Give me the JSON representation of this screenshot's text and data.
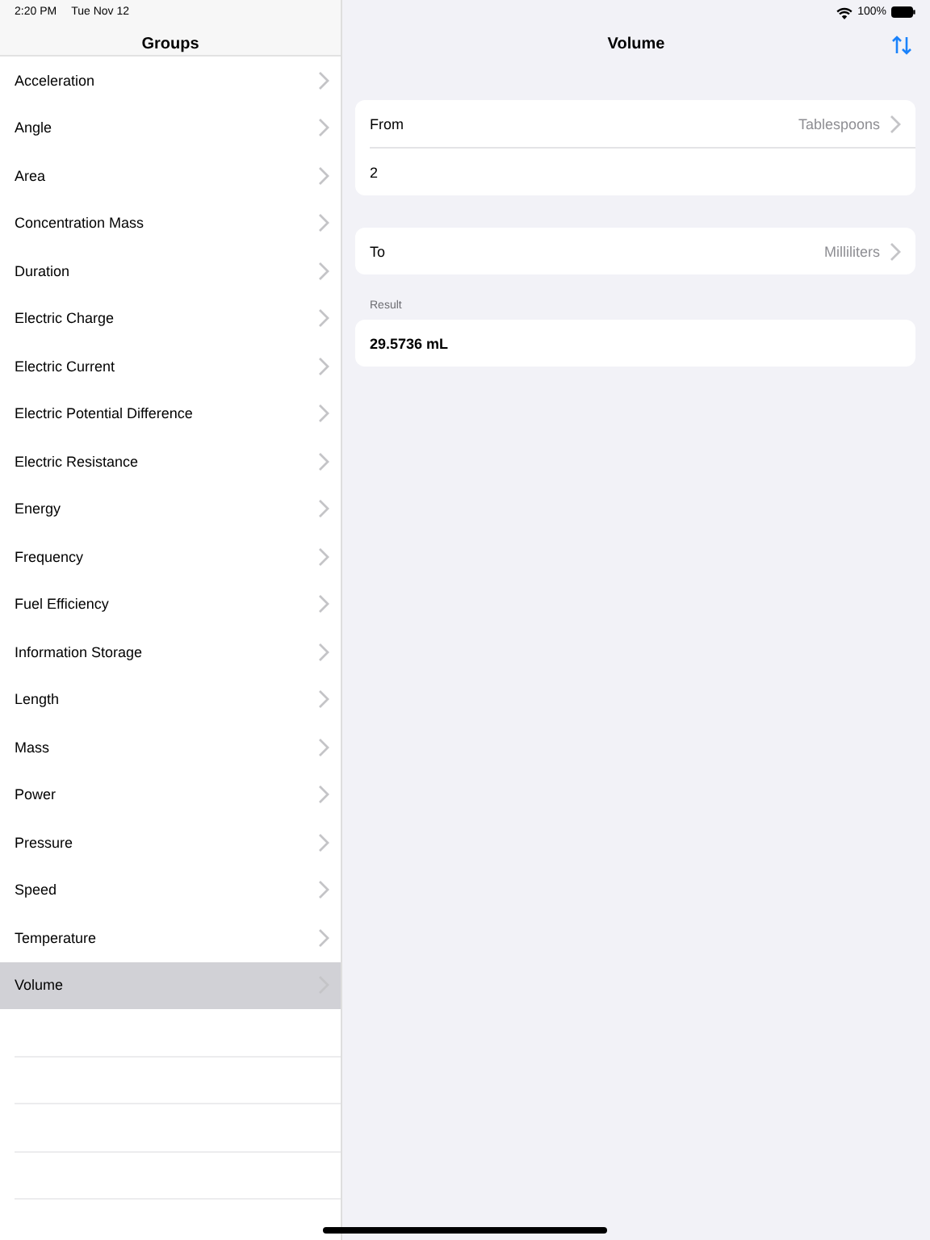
{
  "status_bar": {
    "time": "2:20 PM",
    "date": "Tue Nov 12",
    "battery": "100%"
  },
  "sidebar": {
    "title": "Groups",
    "items": [
      {
        "label": "Acceleration",
        "selected": false
      },
      {
        "label": "Angle",
        "selected": false
      },
      {
        "label": "Area",
        "selected": false
      },
      {
        "label": "Concentration Mass",
        "selected": false
      },
      {
        "label": "Duration",
        "selected": false
      },
      {
        "label": "Electric Charge",
        "selected": false
      },
      {
        "label": "Electric Current",
        "selected": false
      },
      {
        "label": "Electric Potential Difference",
        "selected": false
      },
      {
        "label": "Electric Resistance",
        "selected": false
      },
      {
        "label": "Energy",
        "selected": false
      },
      {
        "label": "Frequency",
        "selected": false
      },
      {
        "label": "Fuel Efficiency",
        "selected": false
      },
      {
        "label": "Information Storage",
        "selected": false
      },
      {
        "label": "Length",
        "selected": false
      },
      {
        "label": "Mass",
        "selected": false
      },
      {
        "label": "Power",
        "selected": false
      },
      {
        "label": "Pressure",
        "selected": false
      },
      {
        "label": "Speed",
        "selected": false
      },
      {
        "label": "Temperature",
        "selected": false
      },
      {
        "label": "Volume",
        "selected": true
      }
    ]
  },
  "detail": {
    "title": "Volume",
    "from": {
      "label": "From",
      "unit": "Tablespoons",
      "value": "2"
    },
    "to": {
      "label": "To",
      "unit": "Milliliters"
    },
    "result": {
      "header": "Result",
      "value": "29.5736 mL"
    }
  }
}
